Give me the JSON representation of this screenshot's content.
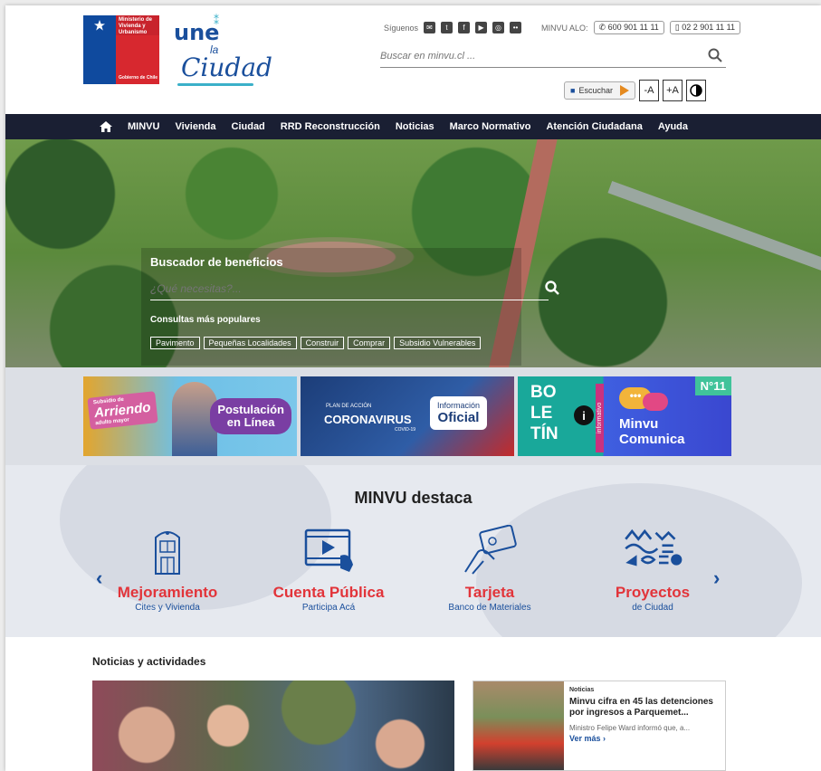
{
  "header": {
    "gov_logo": {
      "line1": "Ministerio de Vivienda y Urbanismo",
      "line2": "Gobierno de Chile"
    },
    "une_logo": {
      "une": "une",
      "la": "la",
      "ciudad": "Ciudad"
    },
    "social_label": "Síguenos",
    "social_icons": [
      "mail-icon",
      "twitter-icon",
      "facebook-icon",
      "youtube-icon",
      "instagram-icon",
      "flickr-icon"
    ],
    "alo_label": "MINVU ALO:",
    "phone1": "600 901 11 11",
    "phone2": "02 2 901 11 11",
    "search_placeholder": "Buscar en minvu.cl ...",
    "escuchar": "Escuchar",
    "font_minus": "-A",
    "font_plus": "+A"
  },
  "nav": {
    "items": [
      "MINVU",
      "Vivienda",
      "Ciudad",
      "RRD Reconstrucción",
      "Noticias",
      "Marco Normativo",
      "Atención Ciudadana",
      "Ayuda"
    ]
  },
  "hero": {
    "title": "Buscador de beneficios",
    "placeholder": "¿Qué necesitas?...",
    "popular_label": "Consultas más populares",
    "tags": [
      "Pavimento",
      "Pequeñas Localidades",
      "Construir",
      "Comprar",
      "Subsidio Vulnerables"
    ]
  },
  "banners": {
    "b1": {
      "subsidio": "Subsidio de",
      "arriendo": "Arriendo",
      "adulto": "adulto mayor",
      "post1": "Postulación",
      "post2": "en Línea"
    },
    "b2": {
      "plan": "PLAN DE ACCIÓN",
      "corona": "CORONAVIRUS",
      "covid": "COVID-19",
      "info1": "Información",
      "info2": "Oficial"
    },
    "b3": {
      "bo": "BO",
      "le": "LE",
      "tin": "TÍN",
      "vert": "informativo",
      "num": "N°11",
      "dots": "•••",
      "minvu": "Minvu",
      "comunica": "Comunica"
    }
  },
  "destaca": {
    "title": "MINVU destaca",
    "items": [
      {
        "title": "Mejoramiento",
        "sub": "Cites y Vivienda",
        "icon": "building-icon"
      },
      {
        "title": "Cuenta Pública",
        "sub": "Participa Acá",
        "icon": "video-play-icon"
      },
      {
        "title": "Tarjeta",
        "sub": "Banco de Materiales",
        "icon": "card-icon"
      },
      {
        "title": "Proyectos",
        "sub": "de Ciudad",
        "icon": "projects-icon"
      }
    ]
  },
  "noticias": {
    "title": "Noticias y actividades",
    "card": {
      "category": "Noticias",
      "title": "Minvu cifra en 45 las detenciones por ingresos a Parquemet...",
      "excerpt": "Ministro Felipe Ward informó que, a...",
      "more": "Ver más"
    }
  },
  "colors": {
    "nav_bg": "#1a1f33",
    "brand_blue": "#1a4f9c",
    "accent_red": "#e2343a"
  }
}
